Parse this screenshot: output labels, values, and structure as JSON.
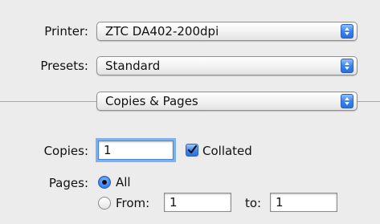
{
  "printer": {
    "label": "Printer:",
    "value": "ZTC DA402-200dpi"
  },
  "presets": {
    "label": "Presets:",
    "value": "Standard"
  },
  "panel": {
    "value": "Copies & Pages"
  },
  "copies": {
    "label": "Copies:",
    "value": "1",
    "collated_label": "Collated",
    "collated_checked": true
  },
  "pages": {
    "label": "Pages:",
    "all_label": "All",
    "all_selected": true,
    "from_label": "From:",
    "from_value": "1",
    "to_label": "to:",
    "to_value": "1"
  },
  "colors": {
    "accent": "#3e86ee",
    "background": "#ececec"
  }
}
